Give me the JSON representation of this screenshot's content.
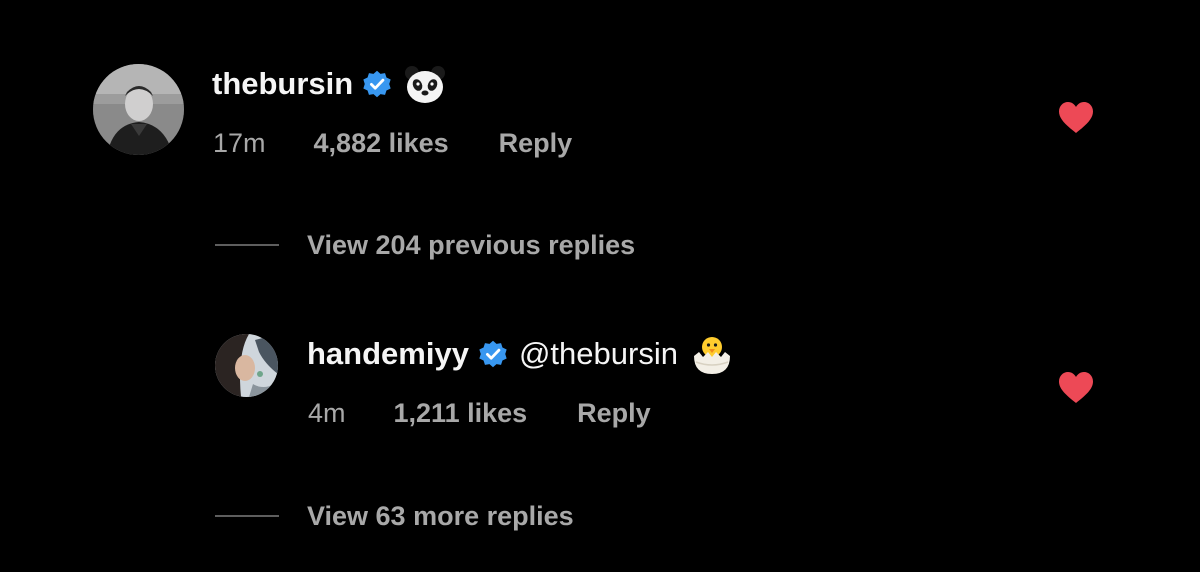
{
  "comments": [
    {
      "username": "thebursin",
      "verified": true,
      "mention": "",
      "emoji_icon": "panda-icon",
      "time": "17m",
      "likes": "4,882 likes",
      "reply_label": "Reply",
      "liked": true
    },
    {
      "username": "handemiyy",
      "verified": true,
      "mention": "@thebursin",
      "emoji_icon": "hatching-chick-icon",
      "time": "4m",
      "likes": "1,211 likes",
      "reply_label": "Reply",
      "liked": true
    }
  ],
  "view_previous_replies": "View 204 previous replies",
  "view_more_replies": "View 63 more replies",
  "colors": {
    "background": "#000000",
    "text_primary": "#f5f5f5",
    "text_secondary": "#a8a8a8",
    "verified_blue": "#3897f0",
    "heart_red": "#ed4956"
  }
}
